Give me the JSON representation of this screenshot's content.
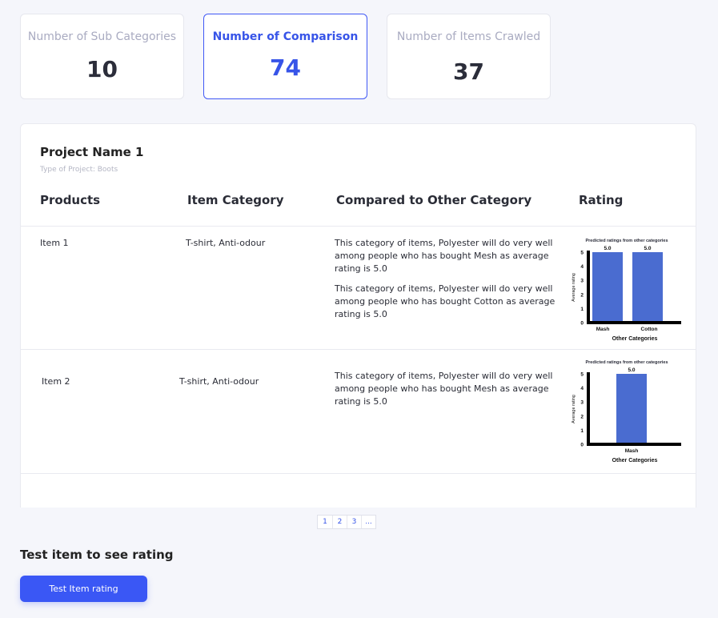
{
  "stats": [
    {
      "label": "Number of Sub Categories",
      "value": "10"
    },
    {
      "label": "Number of Comparison",
      "value": "74"
    },
    {
      "label": "Number of Items Crawled",
      "value": "37"
    }
  ],
  "project": {
    "name": "Project Name 1",
    "type": "Type of Project: Boots"
  },
  "table": {
    "headers": [
      "Products",
      "Item Category",
      "Compared to Other Category",
      "Rating"
    ],
    "rows": [
      {
        "product": "Item 1",
        "category": "T-shirt, Anti-odour",
        "comparisons": [
          "This category of items, Polyester will do very well among people who has bought Mesh as average rating is 5.0",
          "This category of items, Polyester will do very well among people who has bought Cotton as average rating is 5.0"
        ]
      },
      {
        "product": "Item 2",
        "category": "T-shirt, Anti-odour",
        "comparisons": [
          "This category of items, Polyester will do very well among people who has bought Mesh as average rating is 5.0"
        ]
      }
    ]
  },
  "chart_data": [
    {
      "type": "bar",
      "title": "Predicted ratings from other categories",
      "xlabel": "Other Categories",
      "ylabel": "Average rating",
      "categories": [
        "Mash",
        "Cotton"
      ],
      "values": [
        5.0,
        5.0
      ],
      "data_labels": [
        "5.0",
        "5.0"
      ],
      "yticks": [
        "0",
        "1",
        "2",
        "3",
        "4",
        "5"
      ],
      "ylim": [
        0,
        5
      ],
      "bar_color": "#4a6cd0"
    },
    {
      "type": "bar",
      "title": "Predicted ratings from other categories",
      "xlabel": "Other Categories",
      "ylabel": "Average rating",
      "categories": [
        "Mash"
      ],
      "values": [
        5.0
      ],
      "data_labels": [
        "5.0"
      ],
      "yticks": [
        "0",
        "1",
        "2",
        "3",
        "4",
        "5"
      ],
      "ylim": [
        0,
        5
      ],
      "bar_color": "#4a6cd0"
    }
  ],
  "pagination": {
    "pages": [
      "1",
      "2",
      "3",
      "..."
    ]
  },
  "test": {
    "heading": "Test item to see rating",
    "button_label": "Test Item rating"
  },
  "colors": {
    "accent": "#3a57f5",
    "muted": "#a9abc1"
  }
}
